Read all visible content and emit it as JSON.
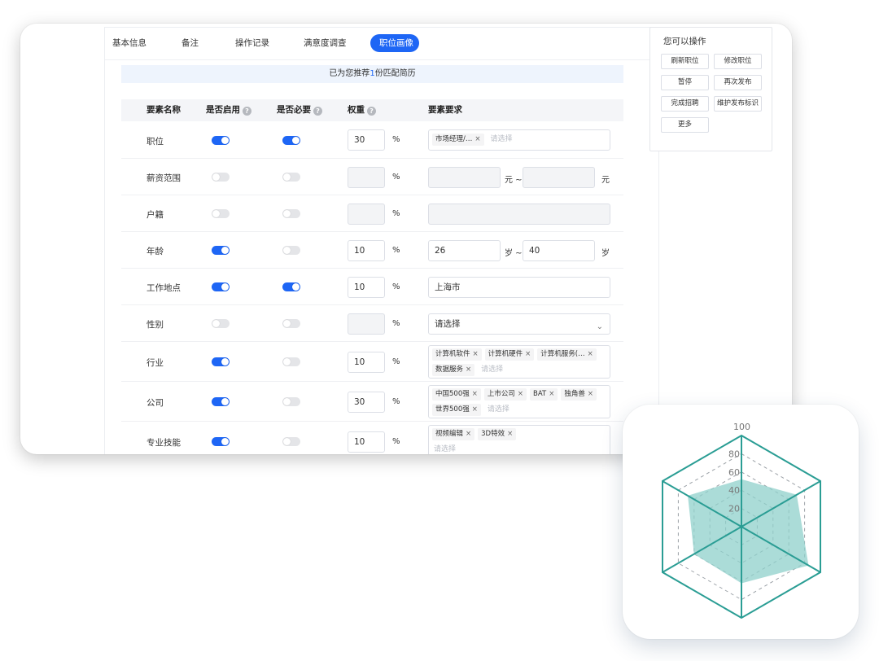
{
  "tabs": [
    "基本信息",
    "备注",
    "操作记录",
    "满意度调查",
    "职位画像"
  ],
  "banner": {
    "prefix": "已为您推荐",
    "count": "1",
    "suffix": "份匹配简历"
  },
  "columns": {
    "name": "要素名称",
    "enabled": "是否启用",
    "required": "是否必要",
    "weight": "权重",
    "requirement": "要素要求"
  },
  "percent_sign": "%",
  "rows": [
    {
      "name": "职位",
      "enabled": true,
      "required": true,
      "weight": "30",
      "tags": [
        [
          "市场经理/…"
        ]
      ],
      "placeholder": "请选择"
    },
    {
      "name": "薪资范围",
      "enabled": false,
      "required": false,
      "weight": "",
      "min": "",
      "max": "",
      "unit_mid": "元 ~",
      "unit_end": "元"
    },
    {
      "name": "户籍",
      "enabled": false,
      "required": false,
      "weight": "",
      "value": ""
    },
    {
      "name": "年龄",
      "enabled": true,
      "required": false,
      "weight": "10",
      "min": "26",
      "max": "40",
      "unit_mid": "岁 ~",
      "unit_end": "岁"
    },
    {
      "name": "工作地点",
      "enabled": true,
      "required": true,
      "weight": "10",
      "value": "上海市"
    },
    {
      "name": "性别",
      "enabled": false,
      "required": false,
      "weight": "",
      "value": "请选择"
    },
    {
      "name": "行业",
      "enabled": true,
      "required": false,
      "weight": "10",
      "tags": [
        [
          "计算机软件",
          "计算机硬件",
          "计算机服务(…"
        ],
        [
          "数据服务"
        ]
      ],
      "placeholder": "请选择"
    },
    {
      "name": "公司",
      "enabled": true,
      "required": false,
      "weight": "30",
      "tags": [
        [
          "中国500强",
          "上市公司",
          "BAT",
          "独角兽"
        ],
        [
          "世界500强"
        ]
      ],
      "placeholder": "请选择"
    },
    {
      "name": "专业技能",
      "enabled": true,
      "required": false,
      "weight": "10",
      "tags": [
        [
          "视频编辑",
          "3D特效"
        ]
      ],
      "placeholder": "请选择"
    }
  ],
  "side_panel": {
    "title": "您可以操作",
    "buttons": [
      "刷新职位",
      "修改职位",
      "暂停",
      "再次发布",
      "完成招聘",
      "维护发布标识",
      "更多"
    ]
  },
  "colors": {
    "primary": "#1e66f5",
    "radar": "#2a9d94",
    "radar_fill": "#8fd0cb"
  },
  "icons": {
    "close": "×",
    "chevron": "chevron-down-icon",
    "help": "?"
  },
  "chart_data": {
    "type": "radar",
    "scale_ticks": [
      "20",
      "40",
      "60",
      "80",
      "100"
    ],
    "max": 100,
    "axes_count": 6,
    "values": [
      52,
      70,
      85,
      62,
      60,
      68
    ]
  }
}
